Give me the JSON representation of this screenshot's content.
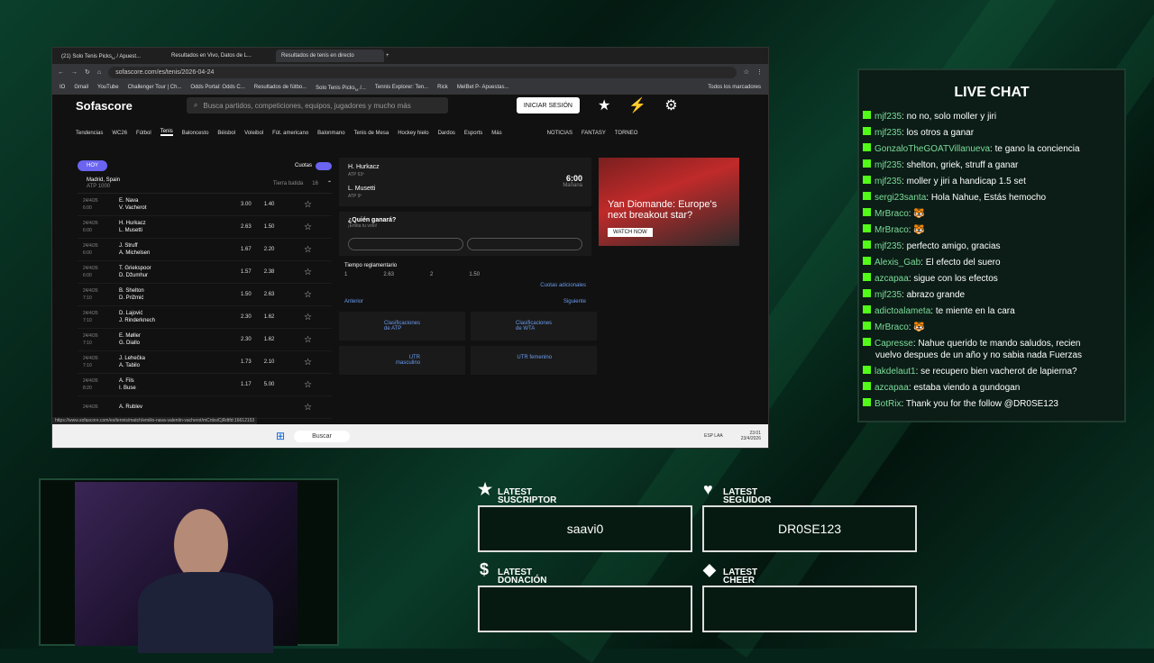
{
  "browser": {
    "tabs": [
      {
        "label": "(21) Solo Tenis Picks␣ / Apuest..."
      },
      {
        "label": "Resultados en Vivo, Datos de L..."
      },
      {
        "label": "Resultados de tenis en directo"
      }
    ],
    "url": "sofascore.com/es/tenis/2026-04-24",
    "bookmarks": [
      "IO",
      "Gmail",
      "YouTube",
      "Challenger Tour | Ch...",
      "Odds Portal: Odds C...",
      "Resultados de fútbo...",
      "Solo Tenis Picks␣ /...",
      "Tennis Explorer: Ten...",
      "Rick",
      "MelBet P- Apuestas...",
      "Todos los marcadores"
    ],
    "status_url": "https://www.sofascore.com/es/tennis/match/emilio-nava-valentin-vacherot/mCnbsiCjRdtfd:16612153"
  },
  "sofascore": {
    "logo": "Sofascore",
    "search_placeholder": "Busca partidos, competiciones, equipos, jugadores y mucho más",
    "login": "INICIAR SESIÓN",
    "nav": [
      "Tendencias",
      "WC26",
      "Fútbol",
      "Tenis",
      "Baloncesto",
      "Béisbol",
      "Voleibol",
      "Fút. americano",
      "Balonmano",
      "Tenis de Mesa",
      "Hockey hielo",
      "Dardos",
      "Esports",
      "Más"
    ],
    "nav_right": [
      "NOTICIAS",
      "FANTASY",
      "TORNEO"
    ],
    "today": "HOY",
    "odds_label": "Cuotas",
    "tournament": {
      "name": "Madrid, Spain",
      "sub": "ATP 1000",
      "surface": "Tierra batida",
      "count": "16"
    },
    "matches": [
      {
        "date": "24/4/26",
        "time": "6:00",
        "p1": "E. Nava",
        "p2": "V. Vacherot",
        "o1": "3.00",
        "o2": "1.40"
      },
      {
        "date": "24/4/26",
        "time": "6:00",
        "p1": "H. Hurkacz",
        "p2": "L. Musetti",
        "o1": "2.63",
        "o2": "1.50"
      },
      {
        "date": "24/4/26",
        "time": "6:00",
        "p1": "J. Struff",
        "p2": "A. Michelsen",
        "o1": "1.67",
        "o2": "2.20"
      },
      {
        "date": "24/4/26",
        "time": "6:00",
        "p1": "T. Griekspoor",
        "p2": "D. Džumhur",
        "o1": "1.57",
        "o2": "2.38"
      },
      {
        "date": "24/4/26",
        "time": "7:10",
        "p1": "B. Shelton",
        "p2": "D. Prižmić",
        "o1": "1.50",
        "o2": "2.63"
      },
      {
        "date": "24/4/26",
        "time": "7:10",
        "p1": "D. Lajović",
        "p2": "J. Rinderknech",
        "o1": "2.30",
        "o2": "1.62"
      },
      {
        "date": "24/4/26",
        "time": "7:10",
        "p1": "E. Møller",
        "p2": "G. Diallo",
        "o1": "2.30",
        "o2": "1.62"
      },
      {
        "date": "24/4/26",
        "time": "7:10",
        "p1": "J. Lehečka",
        "p2": "A. Tabilo",
        "o1": "1.73",
        "o2": "2.10"
      },
      {
        "date": "24/4/26",
        "time": "8:20",
        "p1": "A. Fils",
        "p2": "I. Buse",
        "o1": "1.17",
        "o2": "5.00"
      },
      {
        "date": "24/4/26",
        "time": "",
        "p1": "A. Rublev",
        "p2": "",
        "o1": "",
        "o2": ""
      }
    ],
    "featured": {
      "p1": "H. Hurkacz",
      "p1_rank": "ATP 63º",
      "p2": "L. Musetti",
      "p2_rank": "ATP 9º",
      "time": "6:00",
      "day": "Mañana"
    },
    "vote": {
      "question": "¿Quién ganará?",
      "sub": "¡Emita tu voto!"
    },
    "odds": {
      "label": "Tiempo reglamentario",
      "c1": "1",
      "v1": "2.63",
      "c2": "2",
      "v2": "1.50",
      "more": "Cuotas adicionales"
    },
    "pager": {
      "prev": "Anterior",
      "next": "Siguiente"
    },
    "rankings": [
      "Clasificaciones de ATP",
      "Clasificaciones de WTA",
      "UTR masculino",
      "UTR femenino"
    ],
    "ad": {
      "headline": "Yan Diomande: Europe's next breakout star?",
      "cta": "WATCH NOW"
    }
  },
  "taskbar": {
    "search": "Buscar",
    "lang": "ESP LAA",
    "time": "23:01",
    "date": "23/4/2026"
  },
  "chat": {
    "title": "LIVE CHAT",
    "messages": [
      {
        "user": "mjf235",
        "text": "no no, solo moller y jiri"
      },
      {
        "user": "mjf235",
        "text": "los otros a ganar"
      },
      {
        "user": "GonzaloTheGOATVillanueva",
        "text": "te gano la conciencia"
      },
      {
        "user": "mjf235",
        "text": "shelton, griek, struff a ganar"
      },
      {
        "user": "mjf235",
        "text": "moller y jiri a handicap 1.5 set"
      },
      {
        "user": "sergi23santa",
        "text": "Hola Nahue, Estás hemocho"
      },
      {
        "user": "MrBraco",
        "text": "🐯"
      },
      {
        "user": "MrBraco",
        "text": "🐯"
      },
      {
        "user": "mjf235",
        "text": "perfecto amigo, gracias"
      },
      {
        "user": "Alexis_Gab",
        "text": "El efecto del suero"
      },
      {
        "user": "azcapaa",
        "text": "sigue con los efectos"
      },
      {
        "user": "mjf235",
        "text": "abrazo grande"
      },
      {
        "user": "adictoalameta",
        "text": "te miente en la cara"
      },
      {
        "user": "MrBraco",
        "text": "🐯"
      },
      {
        "user": "Capresse",
        "text": "Nahue querido te mando saludos, recien vuelvo despues de un año y no sabia nada Fuerzas"
      },
      {
        "user": "lakdelaut1",
        "text": "se recupero bien vacherot de lapierna?"
      },
      {
        "user": "azcapaa",
        "text": "estaba viendo a gundogan"
      },
      {
        "user": "BotRix",
        "text": "Thank you for the follow @DR0SE123"
      }
    ]
  },
  "overlay": {
    "sub_label_1": "LATEST",
    "sub_label_2": "SUSCRIPTOR",
    "sub_value": "saavi0",
    "fol_label_1": "LATEST",
    "fol_label_2": "SEGUIDOR",
    "fol_value": "DR0SE123",
    "don_label_1": "LATEST",
    "don_label_2": "DONACIÓN",
    "don_value": "",
    "cheer_label_1": "LATEST",
    "cheer_label_2": "CHEER",
    "cheer_value": ""
  }
}
